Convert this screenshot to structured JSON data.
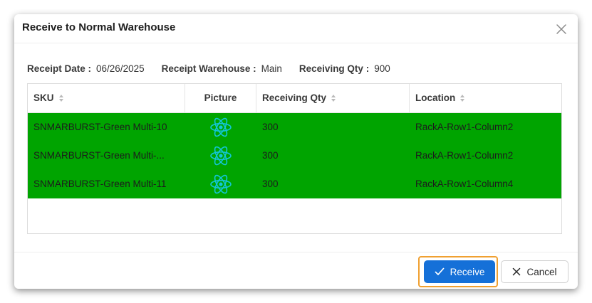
{
  "dialog": {
    "title": "Receive to Normal Warehouse"
  },
  "info": {
    "receipt_date_label": "Receipt Date :",
    "receipt_date_value": "06/26/2025",
    "receipt_warehouse_label": "Receipt Warehouse :",
    "receipt_warehouse_value": "Main",
    "receiving_qty_label": "Receiving Qty :",
    "receiving_qty_value": "900"
  },
  "table": {
    "columns": [
      {
        "label": "SKU",
        "sortable": true
      },
      {
        "label": "Picture",
        "sortable": false
      },
      {
        "label": "Receiving Qty",
        "sortable": true
      },
      {
        "label": "Location",
        "sortable": true
      }
    ],
    "rows": [
      {
        "sku": "SNMARBURST-Green Multi-10",
        "picture_icon": "react-atom-icon",
        "qty": "300",
        "location": "RackA-Row1-Column2"
      },
      {
        "sku": "SNMARBURST-Green Multi-...",
        "picture_icon": "react-atom-icon",
        "qty": "300",
        "location": "RackA-Row1-Column2"
      },
      {
        "sku": "SNMARBURST-Green Multi-11",
        "picture_icon": "react-atom-icon",
        "qty": "300",
        "location": "RackA-Row1-Column4"
      }
    ],
    "row_highlight_color": "#00a400"
  },
  "footer": {
    "receive_label": "Receive",
    "cancel_label": "Cancel"
  },
  "colors": {
    "primary": "#1570d8",
    "focus_ring": "#f0a030",
    "atom_icon": "#13c6d8"
  }
}
